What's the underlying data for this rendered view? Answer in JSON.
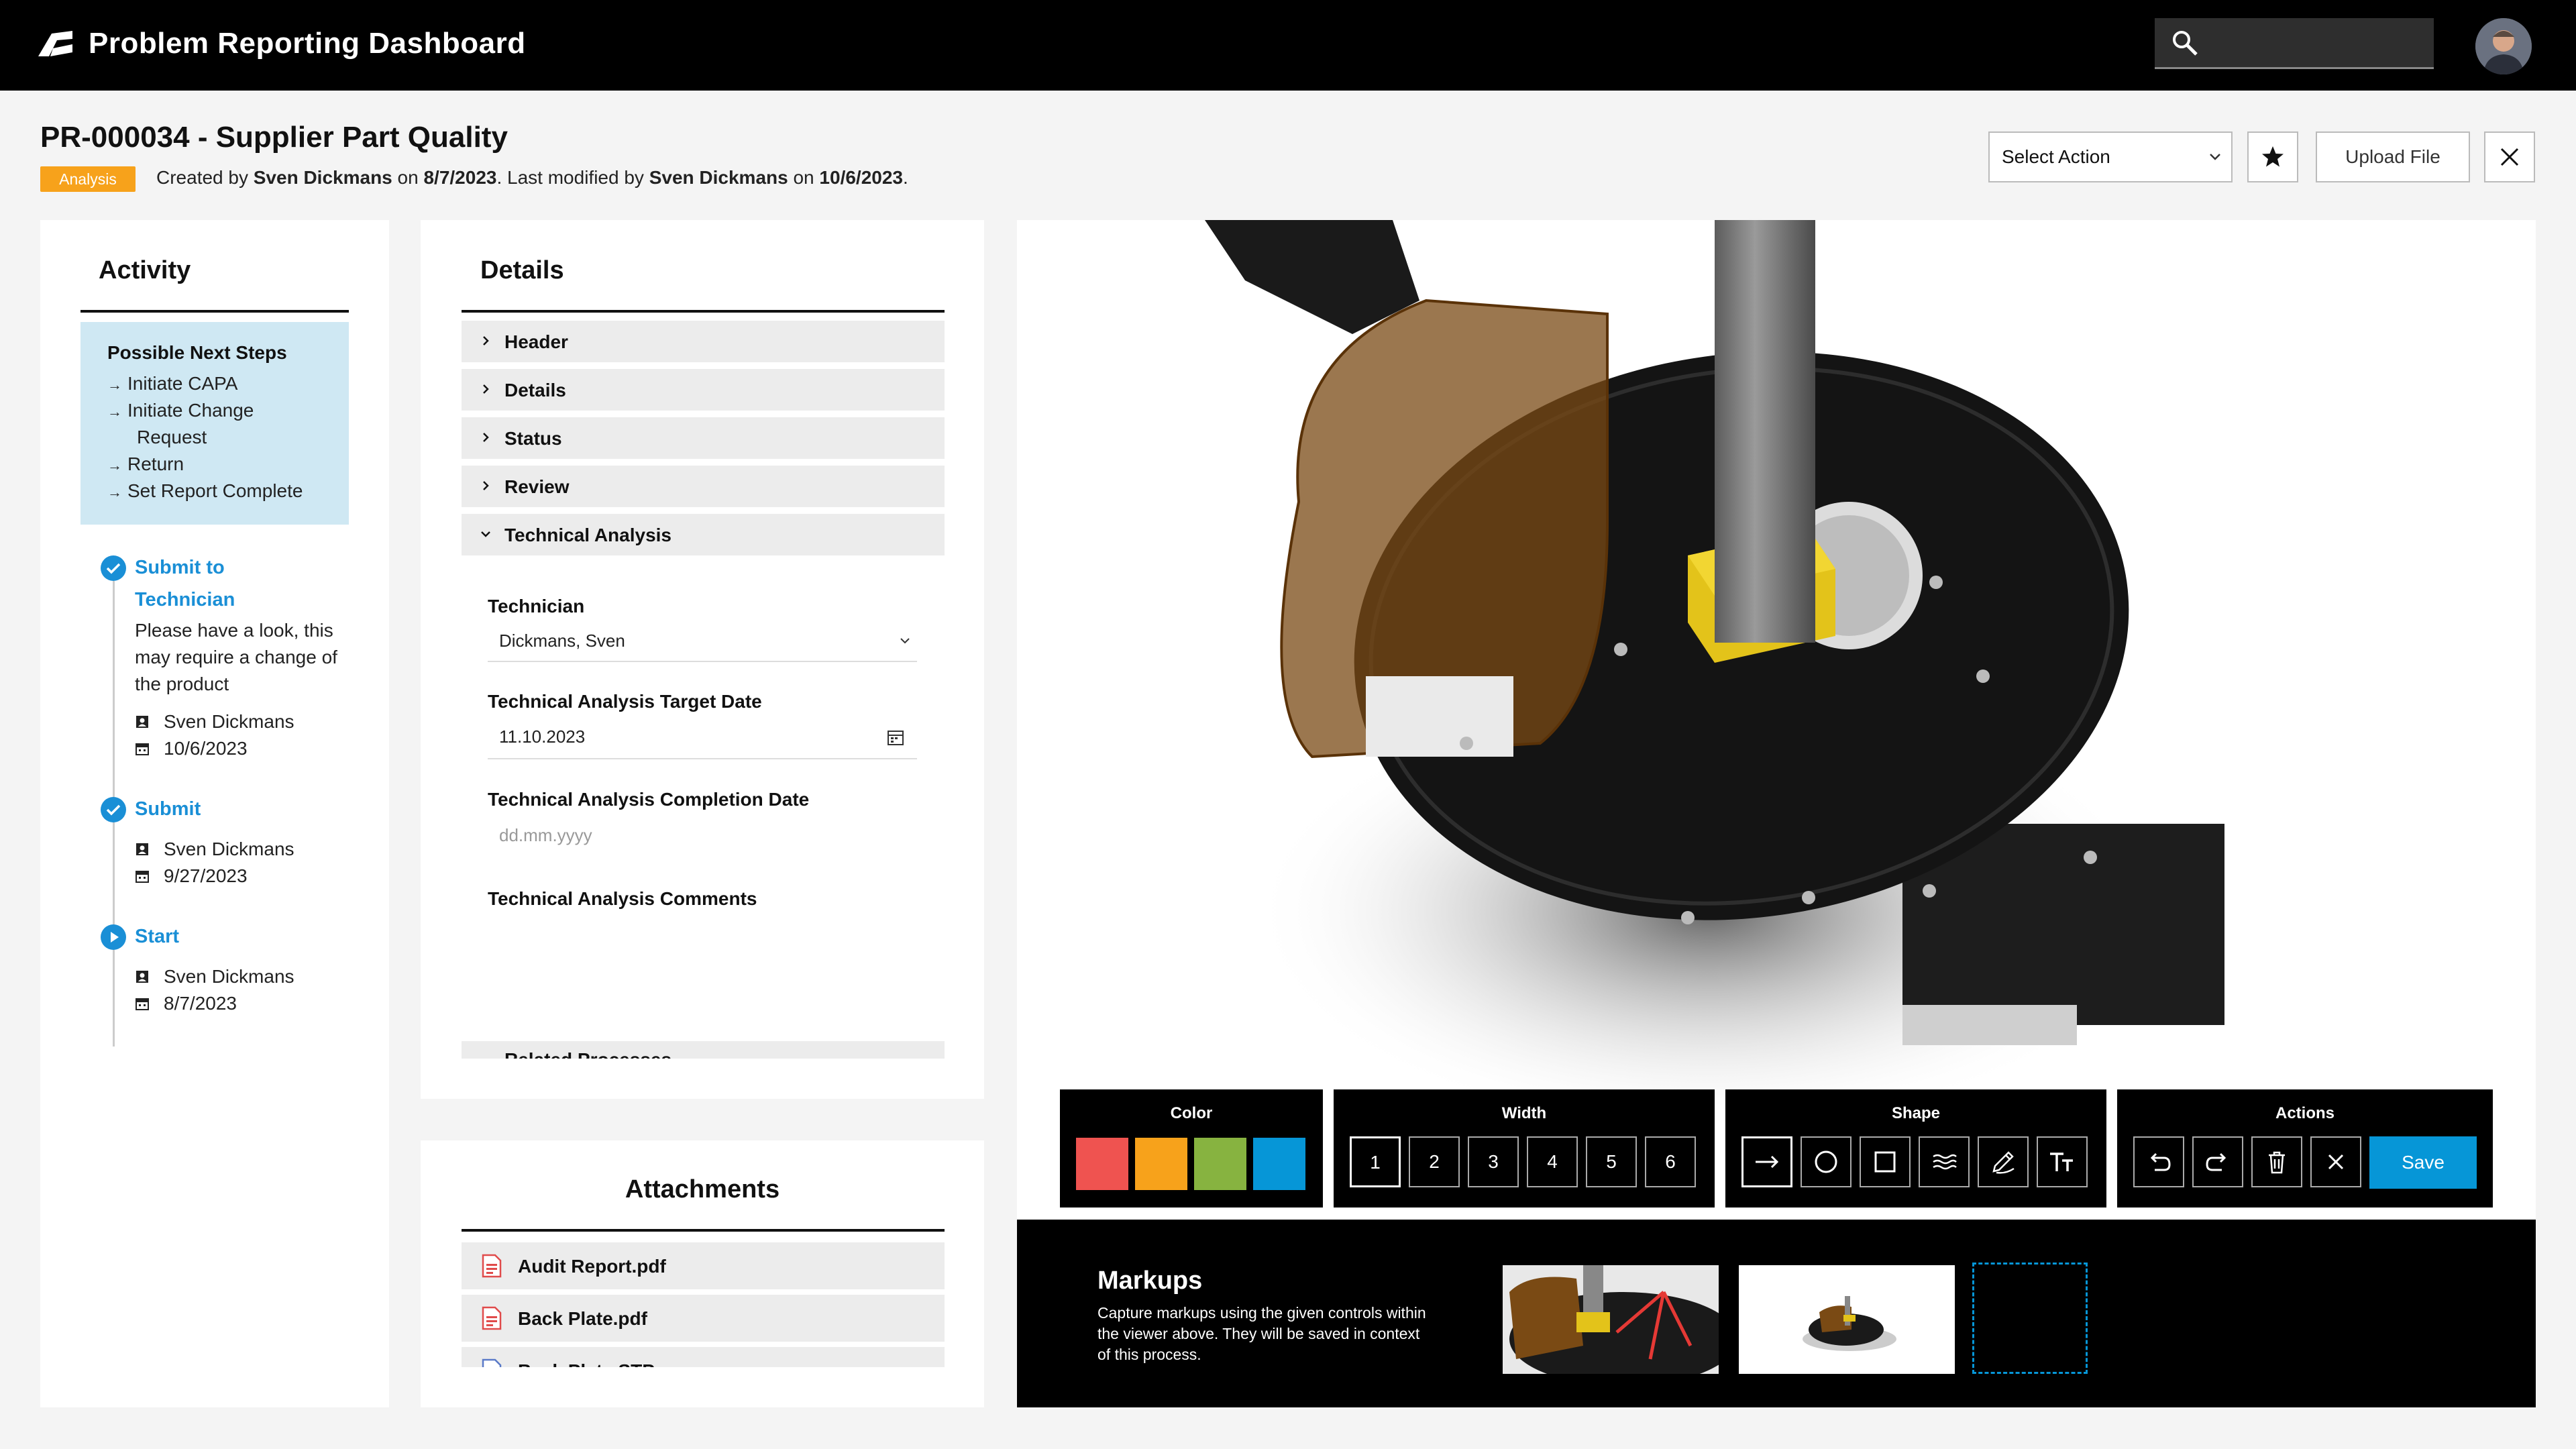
{
  "app": {
    "title": "Problem Reporting Dashboard"
  },
  "header": {
    "record_title": "PR-000034 - Supplier Part Quality",
    "status_badge": "Analysis",
    "meta": {
      "created_prefix": "Created by",
      "created_by": "Sven Dickmans",
      "on1": "on",
      "created_date": "8/7/2023",
      "modified_prefix": ". Last modified by",
      "modified_by": "Sven Dickmans",
      "on2": "on",
      "modified_date": "10/6/2023",
      "end": "."
    },
    "select_action": "Select Action",
    "upload_label": "Upload File"
  },
  "activity": {
    "heading": "Activity",
    "next_steps_title": "Possible Next Steps",
    "next_steps": [
      "Initiate CAPA",
      "Initiate Change",
      "Request",
      "Return",
      "Set Report Complete"
    ],
    "timeline": [
      {
        "title_line1": "Submit to",
        "title_line2": "Technician",
        "comment": [
          "Please have a look, this",
          "may require a change of",
          "the product"
        ],
        "user": "Sven Dickmans",
        "date": "10/6/2023"
      },
      {
        "title_line1": "Submit",
        "user": "Sven Dickmans",
        "date": "9/27/2023"
      },
      {
        "title_line1": "Start",
        "user": "Sven Dickmans",
        "date": "8/7/2023"
      }
    ]
  },
  "details": {
    "heading": "Details",
    "sections": [
      "Header",
      "Details",
      "Status",
      "Review",
      "Technical Analysis"
    ],
    "technician_label": "Technician",
    "technician_value": "Dickmans, Sven",
    "target_label": "Technical Analysis Target Date",
    "target_value": "11.10.2023",
    "completion_label": "Technical Analysis Completion Date",
    "completion_placeholder": "dd.mm.yyyy",
    "comments_label": "Technical Analysis Comments",
    "related_label": "Related Processes"
  },
  "attachments": {
    "heading": "Attachments",
    "files": [
      "Audit Report.pdf",
      "Back Plate.pdf",
      "Back Plate.STP"
    ]
  },
  "toolbar": {
    "color_title": "Color",
    "colors": [
      "#ef5350",
      "#f7a21b",
      "#87b340",
      "#0696d7"
    ],
    "width_title": "Width",
    "widths": [
      "1",
      "2",
      "3",
      "4",
      "5",
      "6"
    ],
    "shape_title": "Shape",
    "actions_title": "Actions",
    "save_label": "Save"
  },
  "markups": {
    "title": "Markups",
    "description": "Capture markups using the given controls within the viewer above. They will be saved in context of this process."
  }
}
